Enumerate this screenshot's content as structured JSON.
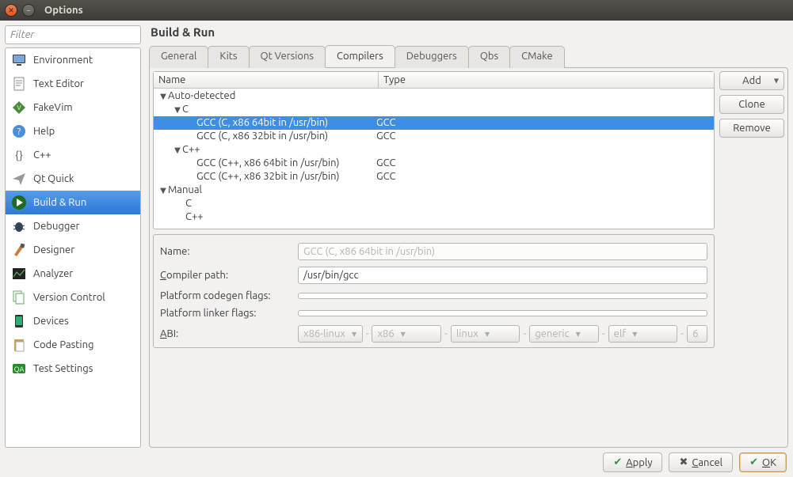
{
  "window": {
    "title": "Options"
  },
  "filter": {
    "placeholder": "Filter"
  },
  "sidebar": {
    "items": [
      {
        "label": "Environment"
      },
      {
        "label": "Text Editor"
      },
      {
        "label": "FakeVim"
      },
      {
        "label": "Help"
      },
      {
        "label": "C++"
      },
      {
        "label": "Qt Quick"
      },
      {
        "label": "Build & Run"
      },
      {
        "label": "Debugger"
      },
      {
        "label": "Designer"
      },
      {
        "label": "Analyzer"
      },
      {
        "label": "Version Control"
      },
      {
        "label": "Devices"
      },
      {
        "label": "Code Pasting"
      },
      {
        "label": "Test Settings"
      }
    ]
  },
  "page": {
    "title": "Build & Run"
  },
  "tabs": {
    "items": [
      {
        "label": "General"
      },
      {
        "label": "Kits"
      },
      {
        "label": "Qt Versions"
      },
      {
        "label": "Compilers"
      },
      {
        "label": "Debuggers"
      },
      {
        "label": "Qbs"
      },
      {
        "label": "CMake"
      }
    ]
  },
  "table": {
    "headers": {
      "name": "Name",
      "type": "Type"
    },
    "groups": {
      "auto": "Auto-detected",
      "manual": "Manual",
      "c": "C",
      "cpp": "C++"
    },
    "rows": {
      "gcc_c64": {
        "name": "GCC (C, x86 64bit in /usr/bin)",
        "type": "GCC"
      },
      "gcc_c32": {
        "name": "GCC (C, x86 32bit in /usr/bin)",
        "type": "GCC"
      },
      "gcc_cpp64": {
        "name": "GCC (C++, x86 64bit in /usr/bin)",
        "type": "GCC"
      },
      "gcc_cpp32": {
        "name": "GCC (C++, x86 32bit in /usr/bin)",
        "type": "GCC"
      },
      "man_c": "C",
      "man_cpp": "C++"
    }
  },
  "buttons": {
    "add": "Add",
    "clone": "Clone",
    "remove": "Remove"
  },
  "form": {
    "name_label": "Name:",
    "name_value": "GCC (C, x86 64bit in /usr/bin)",
    "path_label_pre": "C",
    "path_label_post": "ompiler path:",
    "path_value": "/usr/bin/gcc",
    "codegen_label": "Platform codegen flags:",
    "linker_label": "Platform linker flags:",
    "abi_label_pre": "A",
    "abi_label_post": "BI:",
    "abi": {
      "arch": "x86-linux",
      "sub": "x86",
      "os": "linux",
      "flavor": "generic",
      "fmt": "elf",
      "width": "6"
    }
  },
  "footer": {
    "apply_pre": "",
    "apply_u": "A",
    "apply_post": "pply",
    "cancel_pre": "",
    "cancel_u": "C",
    "cancel_post": "ancel",
    "ok_pre": "",
    "ok_u": "O",
    "ok_post": "K"
  }
}
